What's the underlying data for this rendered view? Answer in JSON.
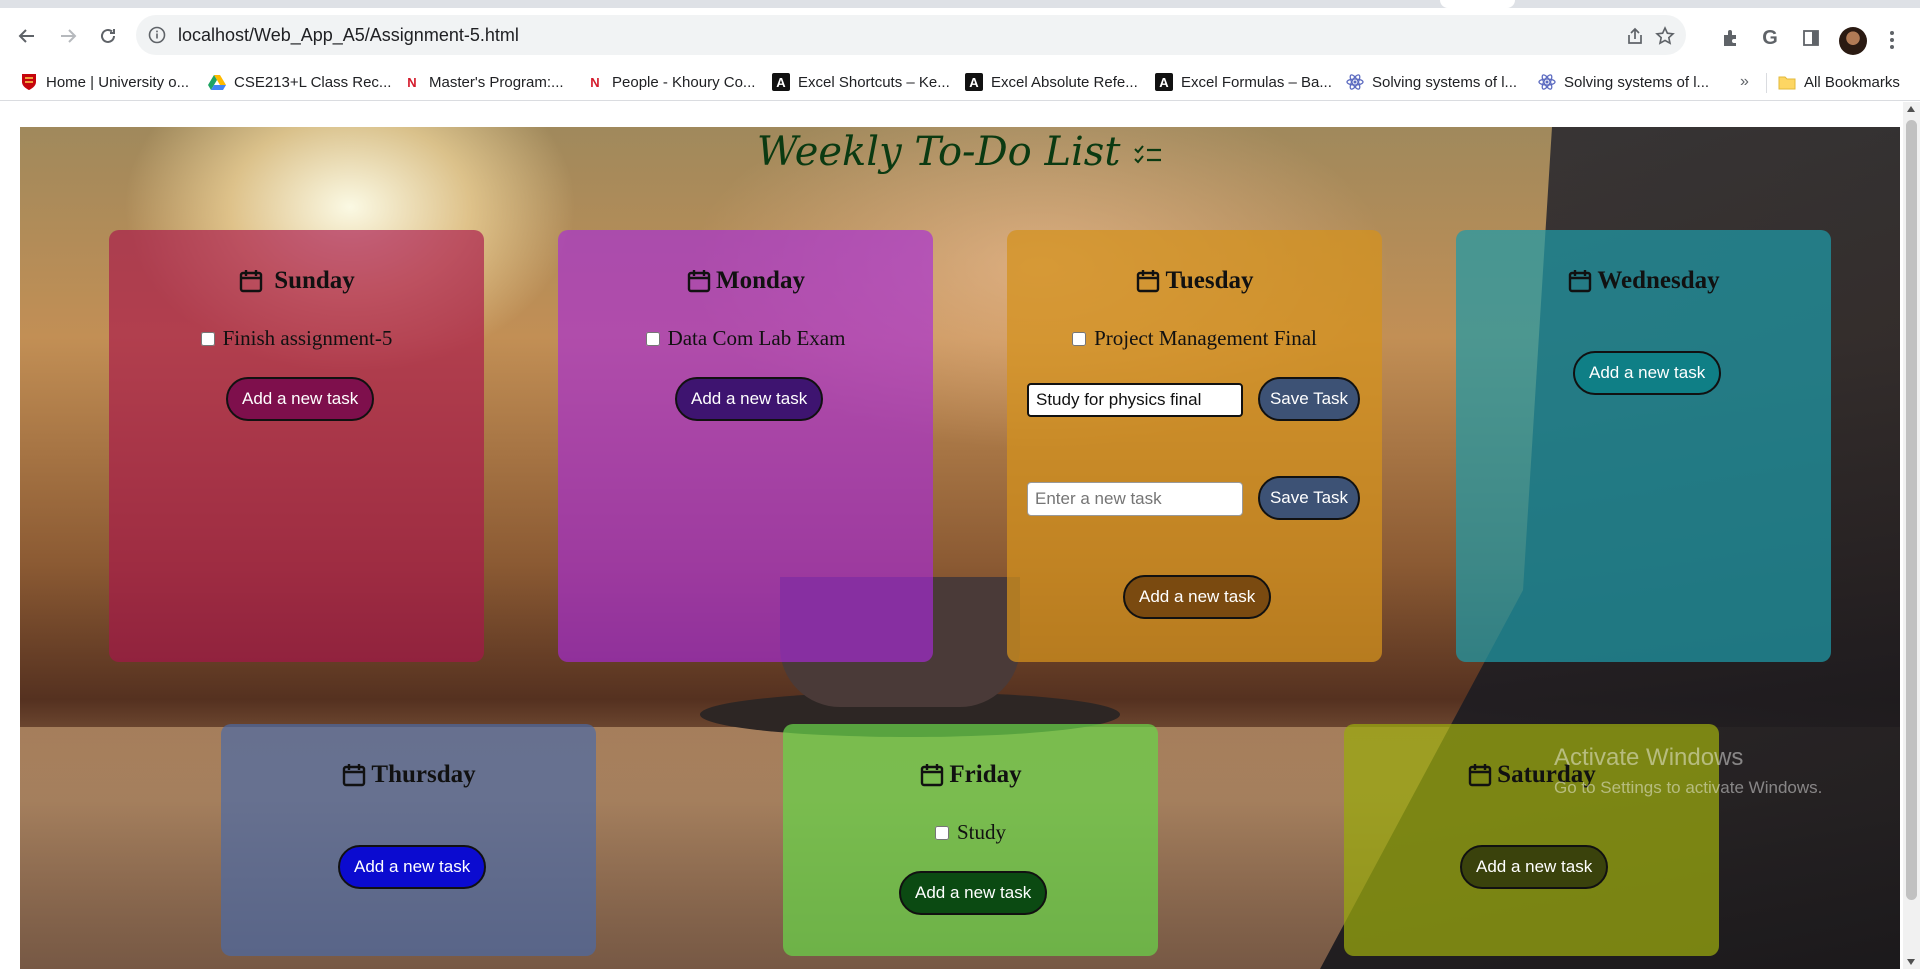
{
  "browser": {
    "url": "localhost/Web_App_A5/Assignment-5.html",
    "bookmarks": [
      {
        "label": "Home | University o...",
        "icon": "university-crest-icon",
        "color": "#c5050c"
      },
      {
        "label": "CSE213+L Class Rec...",
        "icon": "google-drive-icon",
        "color": "#1fa463"
      },
      {
        "label": "Master's Program:...",
        "icon": "northeastern-n-icon",
        "color": "#d41b2c"
      },
      {
        "label": "People - Khoury Co...",
        "icon": "northeastern-n-icon",
        "color": "#d41b2c"
      },
      {
        "label": "Excel Shortcuts – Ke...",
        "icon": "excel-jet-icon",
        "color": "#111111"
      },
      {
        "label": "Excel Absolute Refe...",
        "icon": "excel-jet-icon",
        "color": "#111111"
      },
      {
        "label": "Excel Formulas – Ba...",
        "icon": "excel-jet-icon",
        "color": "#111111"
      },
      {
        "label": "Solving systems of l...",
        "icon": "atom-icon",
        "color": "#5c6bc0"
      },
      {
        "label": "Solving systems of l...",
        "icon": "atom-icon",
        "color": "#5c6bc0"
      }
    ],
    "more_bookmarks": "»",
    "all_bookmarks": "All Bookmarks"
  },
  "page": {
    "title": "Weekly To-Do List",
    "title_icon": "checklist-icon"
  },
  "days": {
    "sunday": {
      "name": "Sunday",
      "color": "#a8154a",
      "tasks": [
        "Finish assignment-5"
      ],
      "add_label": "Add a new task",
      "button_color": "#7e0f4c"
    },
    "monday": {
      "name": "Monday",
      "color": "#a72ad8",
      "tasks": [
        "Data Com Lab Exam"
      ],
      "add_label": "Add a new task",
      "button_color": "#3e1470"
    },
    "tuesday": {
      "name": "Tuesday",
      "color": "#d4921e",
      "tasks": [
        "Project Management Final"
      ],
      "inputs": [
        {
          "value": "Study for physics final",
          "placeholder": "",
          "save_label": "Save Task"
        },
        {
          "value": "",
          "placeholder": "Enter a new task",
          "save_label": "Save Task"
        }
      ],
      "add_label": "Add a new task",
      "button_color": "#7a4a10"
    },
    "wednesday": {
      "name": "Wednesday",
      "color": "#1f9aa8",
      "tasks": [],
      "add_label": "Add a new task",
      "button_color": "#0f7f86"
    },
    "thursday": {
      "name": "Thursday",
      "color": "#4a6aa8",
      "tasks": [],
      "add_label": "Add a new task",
      "button_color": "#0b0bd0"
    },
    "friday": {
      "name": "Friday",
      "color": "#6ad44a",
      "tasks": [
        "Study"
      ],
      "add_label": "Add a new task",
      "button_color": "#0b4a12"
    },
    "saturday": {
      "name": "Saturday",
      "color": "#9aa80f",
      "tasks": [],
      "add_label": "Add a new task",
      "button_color": "#3a420c"
    }
  },
  "watermark": {
    "line1": "Activate Windows",
    "line2": "Go to Settings to activate Windows."
  }
}
